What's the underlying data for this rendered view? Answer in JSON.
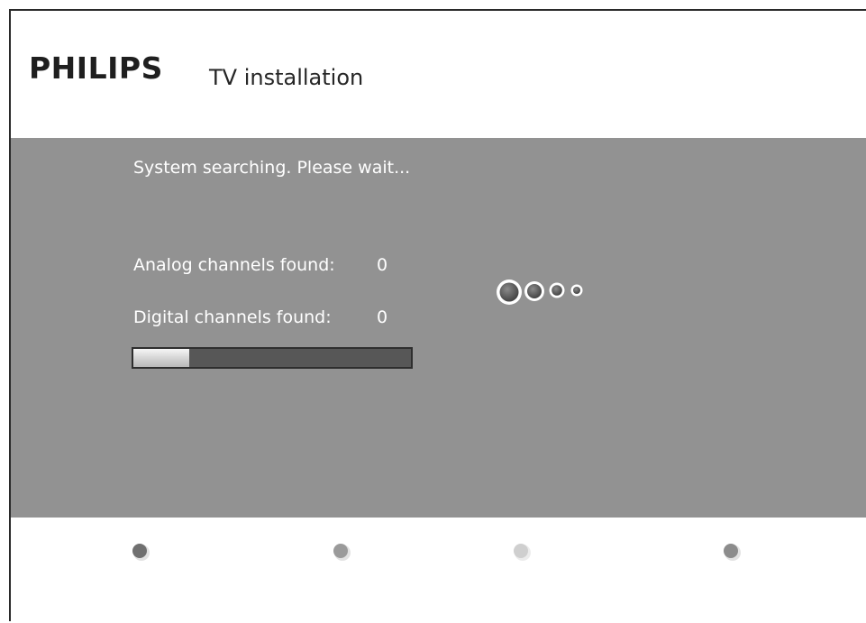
{
  "header": {
    "brand": "PHILIPS",
    "title": "TV installation"
  },
  "status": {
    "message": "System searching. Please wait..."
  },
  "channels": {
    "analog_label": "Analog channels found:",
    "analog_count": "0",
    "digital_label": "Digital channels found:",
    "digital_count": "0"
  },
  "progress": {
    "fraction": 0.2
  },
  "spinner": {
    "icon": "busy-dots-icon"
  },
  "footer": {
    "keys": [
      {
        "name": "red-key-icon",
        "color": "#707070"
      },
      {
        "name": "green-key-icon",
        "color": "#9a9a9a"
      },
      {
        "name": "yellow-key-icon",
        "color": "#cfcfcf"
      },
      {
        "name": "blue-key-icon",
        "color": "#8c8c8c"
      }
    ]
  },
  "colors": {
    "panel_background": "#929292",
    "text": "#ffffff"
  }
}
